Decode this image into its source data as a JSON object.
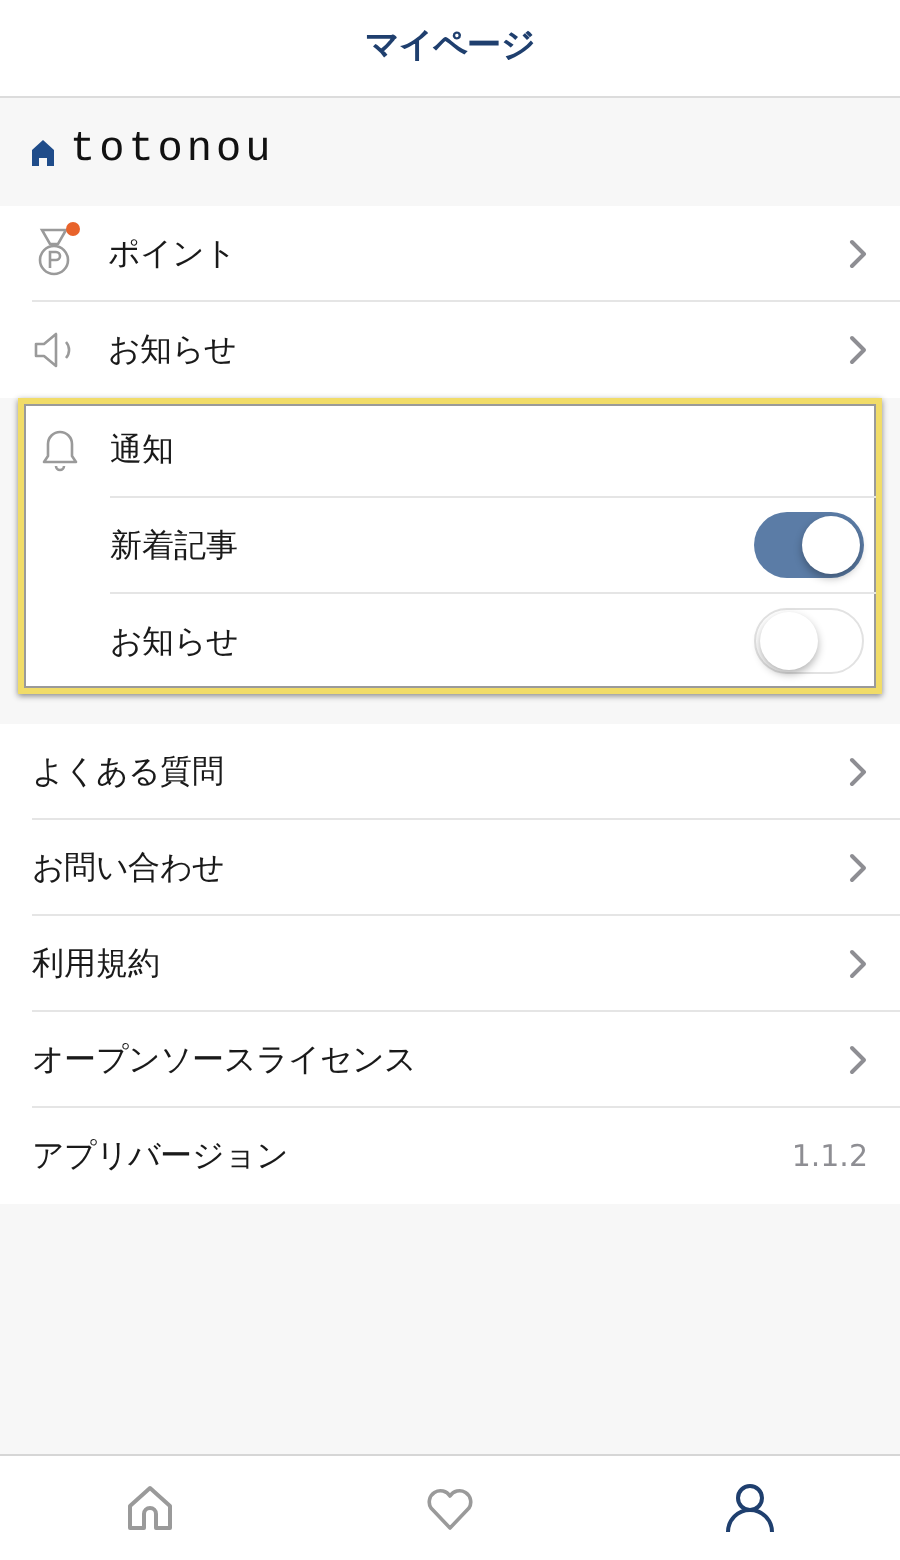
{
  "header": {
    "title": "マイページ"
  },
  "brand": {
    "name": "totonou"
  },
  "top_items": [
    {
      "kind": "medal",
      "label": "ポイント",
      "badge": true
    },
    {
      "kind": "speaker",
      "label": "お知らせ",
      "badge": false
    }
  ],
  "notifications": {
    "title": "通知",
    "highlighted": true,
    "toggles": [
      {
        "label": "新着記事",
        "on": true
      },
      {
        "label": "お知らせ",
        "on": false
      }
    ]
  },
  "menu": [
    {
      "label": "よくある質問",
      "kind": "link"
    },
    {
      "label": "お問い合わせ",
      "kind": "link"
    },
    {
      "label": "利用規約",
      "kind": "link"
    },
    {
      "label": "オープンソースライセンス",
      "kind": "link"
    },
    {
      "label": "アプリバージョン",
      "kind": "value",
      "value": "1.1.2"
    }
  ],
  "tab_bar": [
    {
      "kind": "home",
      "selected": false
    },
    {
      "kind": "heart",
      "selected": false
    },
    {
      "kind": "person",
      "selected": true
    }
  ]
}
